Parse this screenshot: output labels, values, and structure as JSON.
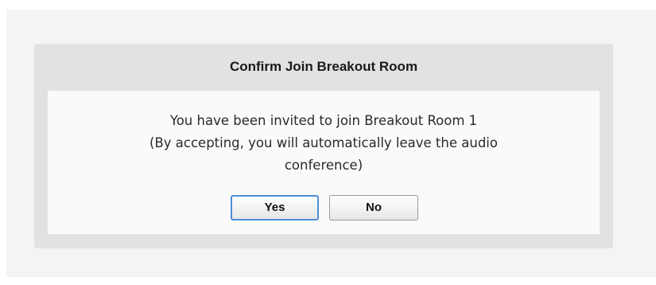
{
  "dialog": {
    "title": "Confirm Join Breakout Room",
    "message_lines": [
      "You have been invited to join Breakout Room 1",
      "(By accepting, you will automatically leave the audio",
      "conference)"
    ],
    "yes_label": "Yes",
    "no_label": "No",
    "focused_button": "Yes"
  },
  "colors": {
    "dialog_bg": "#e2e2e2",
    "body_bg": "#fafafa",
    "focus_border": "#4a8fd4"
  }
}
